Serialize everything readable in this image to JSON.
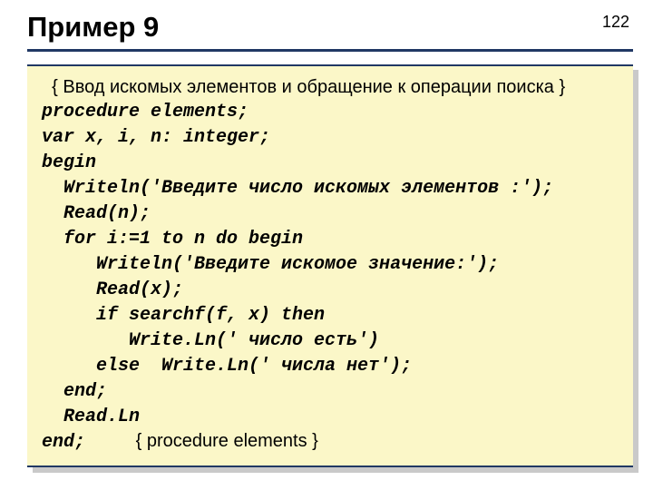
{
  "title": "Пример 9",
  "page_number": "122",
  "code": {
    "comment": "  { Ввод искомых элементов и обращение к операции поиска }",
    "l1": "procedure elements;",
    "l2": "var x, i, n: integer;",
    "l3": "begin",
    "l4": "  Writeln('Введите число искомых элементов :');",
    "l5": "  Read(n);",
    "l6": "  for i:=1 to n do begin",
    "l7": "     Writeln('Введите искомое значение:');",
    "l8": "     Read(x);",
    "l9": "     if searchf(f, x) then",
    "l10": "        Write.Ln(' число есть')",
    "l11": "     else  Write.Ln(' числа нет');",
    "l12": "  end;",
    "l13": "  Read.Ln",
    "l14a": "end;",
    "l14b": "{ procedure elements }"
  }
}
